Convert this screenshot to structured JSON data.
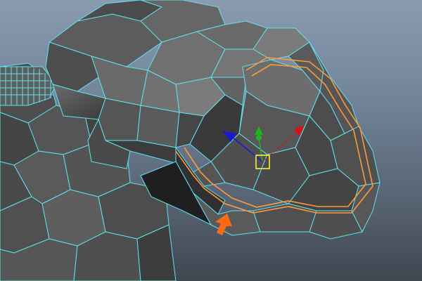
{
  "viewport": {
    "type": "3d-modeling-perspective-view",
    "mode": "component-face-selection",
    "model": "low-poly-creature-head",
    "wireframe_color": "#5ee3f0",
    "selection_edge_color": "#ff9a3a",
    "background_top": "#8a9bb0",
    "background_bottom": "#3f4650"
  },
  "manipulator": {
    "tool": "move-tool",
    "x_axis_color": "#e01010",
    "y_axis_color": "#22b322",
    "z_axis_color": "#1a1ad6",
    "center_handle_color": "#ffff33"
  },
  "annotation": {
    "icon": "arrow-icon",
    "color": "#ff6a13",
    "points_to": "selected-edge-loop"
  }
}
